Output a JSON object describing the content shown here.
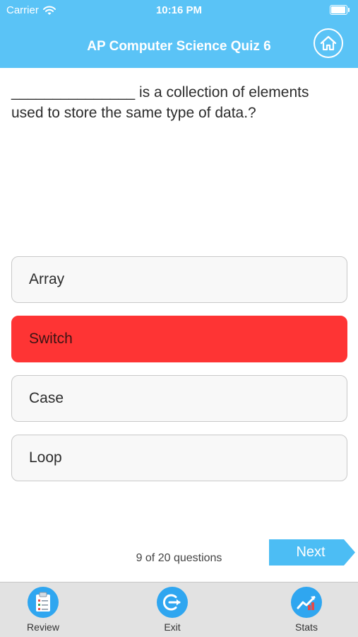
{
  "status_bar": {
    "carrier": "Carrier",
    "time": "10:16 PM",
    "icons": [
      "wifi-icon",
      "battery-icon"
    ]
  },
  "header": {
    "title": "AP Computer Science Quiz 6",
    "home_icon": "home-icon",
    "background_color": "#5ac3f6"
  },
  "question": {
    "text": "_______________ is a collection of elements used to store the same type of data.?"
  },
  "answers": [
    {
      "label": "Array",
      "state": "normal"
    },
    {
      "label": "Switch",
      "state": "wrong"
    },
    {
      "label": "Case",
      "state": "normal"
    },
    {
      "label": "Loop",
      "state": "normal"
    }
  ],
  "colors": {
    "wrong_answer": "#fe3434",
    "accent": "#2fa6f0",
    "next_button": "#4cbdf4"
  },
  "progress": {
    "text": "9 of 20 questions",
    "current": 9,
    "total": 20
  },
  "next_button": {
    "label": "Next"
  },
  "tabs": [
    {
      "label": "Review",
      "icon": "clipboard-icon"
    },
    {
      "label": "Exit",
      "icon": "exit-icon"
    },
    {
      "label": "Stats",
      "icon": "stats-chart-icon"
    }
  ]
}
